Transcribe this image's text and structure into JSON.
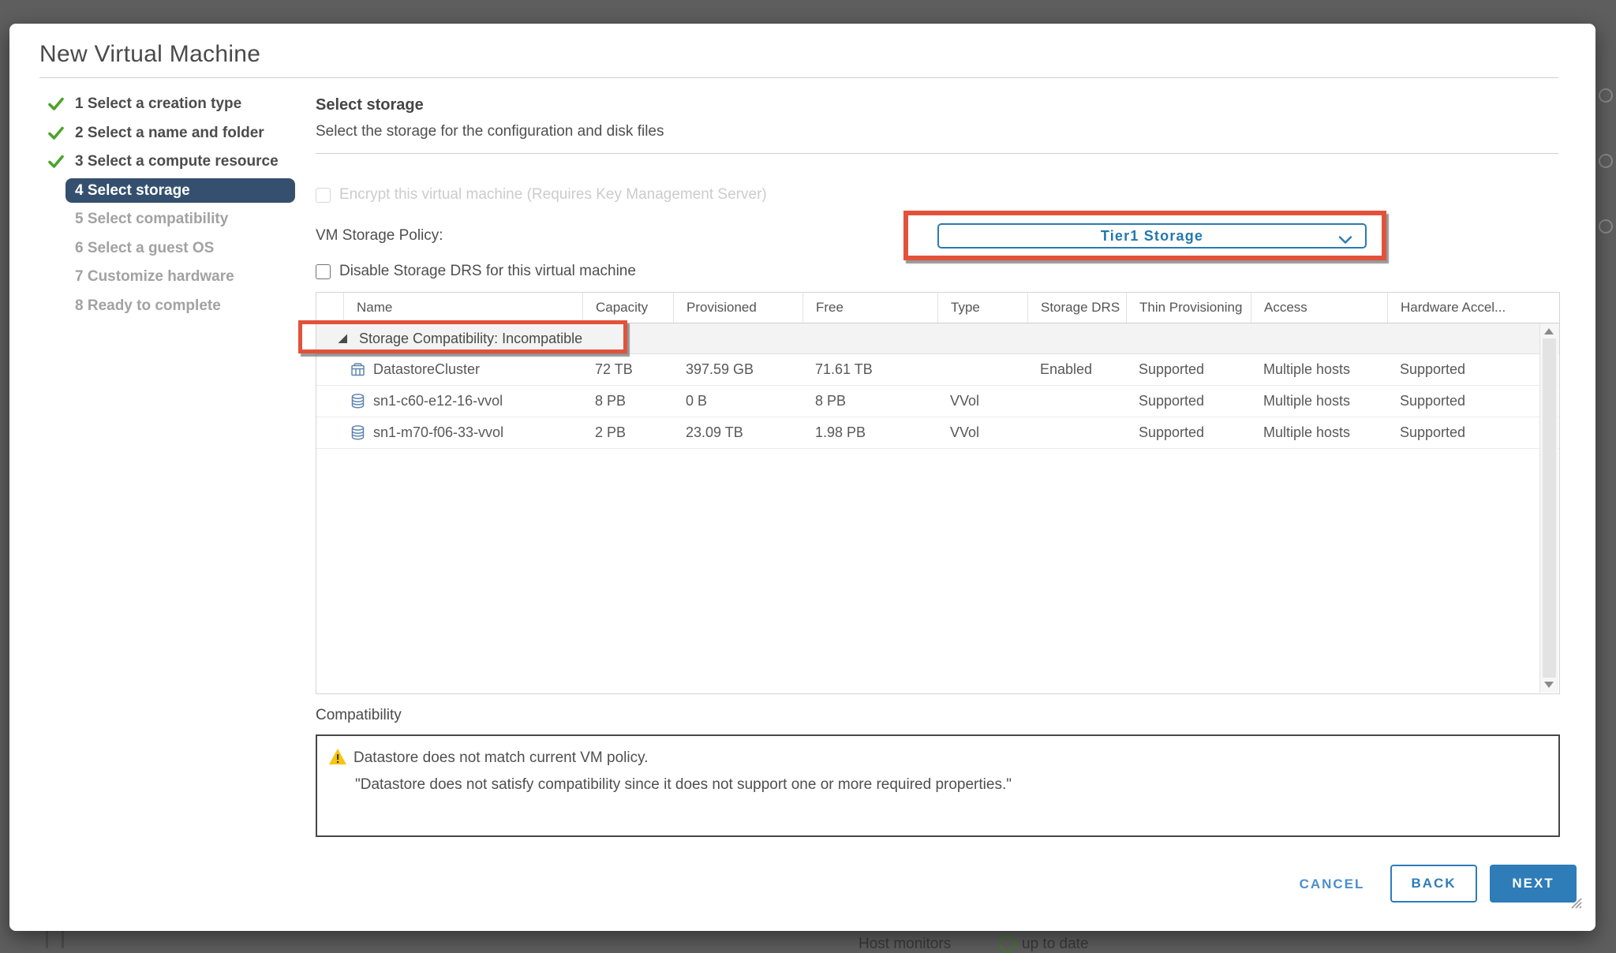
{
  "window": {
    "title": "New Virtual Machine"
  },
  "steps": [
    {
      "label": "1 Select a creation type",
      "state": "done"
    },
    {
      "label": "2 Select a name and folder",
      "state": "done"
    },
    {
      "label": "3 Select a compute resource",
      "state": "done"
    },
    {
      "label": "4 Select storage",
      "state": "active"
    },
    {
      "label": "5 Select compatibility",
      "state": "upcoming"
    },
    {
      "label": "6 Select a guest OS",
      "state": "upcoming"
    },
    {
      "label": "7 Customize hardware",
      "state": "upcoming"
    },
    {
      "label": "8 Ready to complete",
      "state": "upcoming"
    }
  ],
  "content": {
    "heading": "Select storage",
    "subheading": "Select the storage for the configuration and disk files",
    "encrypt_checkbox_label": "Encrypt this virtual machine (Requires Key Management Server)",
    "vm_storage_policy_label": "VM Storage Policy:",
    "vm_storage_policy_value": "Tier1 Storage",
    "disable_drs_checkbox_label": "Disable Storage DRS for this virtual machine"
  },
  "table": {
    "columns": [
      "Name",
      "Capacity",
      "Provisioned",
      "Free",
      "Type",
      "Storage DRS",
      "Thin Provisioning",
      "Access",
      "Hardware Accel..."
    ],
    "group_row_label": "Storage Compatibility: Incompatible",
    "rows": [
      {
        "name": "DatastoreCluster",
        "icon": "datastore-cluster-icon",
        "capacity": "72 TB",
        "provisioned": "397.59 GB",
        "free": "71.61 TB",
        "type": "",
        "storage_drs": "Enabled",
        "thin_provisioning": "Supported",
        "access": "Multiple hosts",
        "hardware_accel": "Supported"
      },
      {
        "name": "sn1-c60-e12-16-vvol",
        "icon": "datastore-icon",
        "capacity": "8 PB",
        "provisioned": "0 B",
        "free": "8 PB",
        "type": "VVol",
        "storage_drs": "",
        "thin_provisioning": "Supported",
        "access": "Multiple hosts",
        "hardware_accel": "Supported"
      },
      {
        "name": "sn1-m70-f06-33-vvol",
        "icon": "datastore-icon",
        "capacity": "2 PB",
        "provisioned": "23.09 TB",
        "free": "1.98 PB",
        "type": "VVol",
        "storage_drs": "",
        "thin_provisioning": "Supported",
        "access": "Multiple hosts",
        "hardware_accel": "Supported"
      }
    ]
  },
  "compatibility": {
    "label": "Compatibility",
    "message_line1": "Datastore does not match current VM policy.",
    "message_line2": "\"Datastore does not satisfy compatibility since it does not support one or more required properties.\""
  },
  "footer": {
    "cancel_label": "CANCEL",
    "back_label": "BACK",
    "next_label": "NEXT"
  },
  "background": {
    "bottom_fragment_left": "Host monitors",
    "bottom_fragment_right": "up to date"
  },
  "colors": {
    "accent_blue": "#2e7cb8",
    "annotation_red": "#e2523a",
    "active_step_bg": "#35506f",
    "success_green": "#4ca32a",
    "warning_yellow": "#f5c511",
    "backdrop_gray": "#5e5e5e"
  }
}
